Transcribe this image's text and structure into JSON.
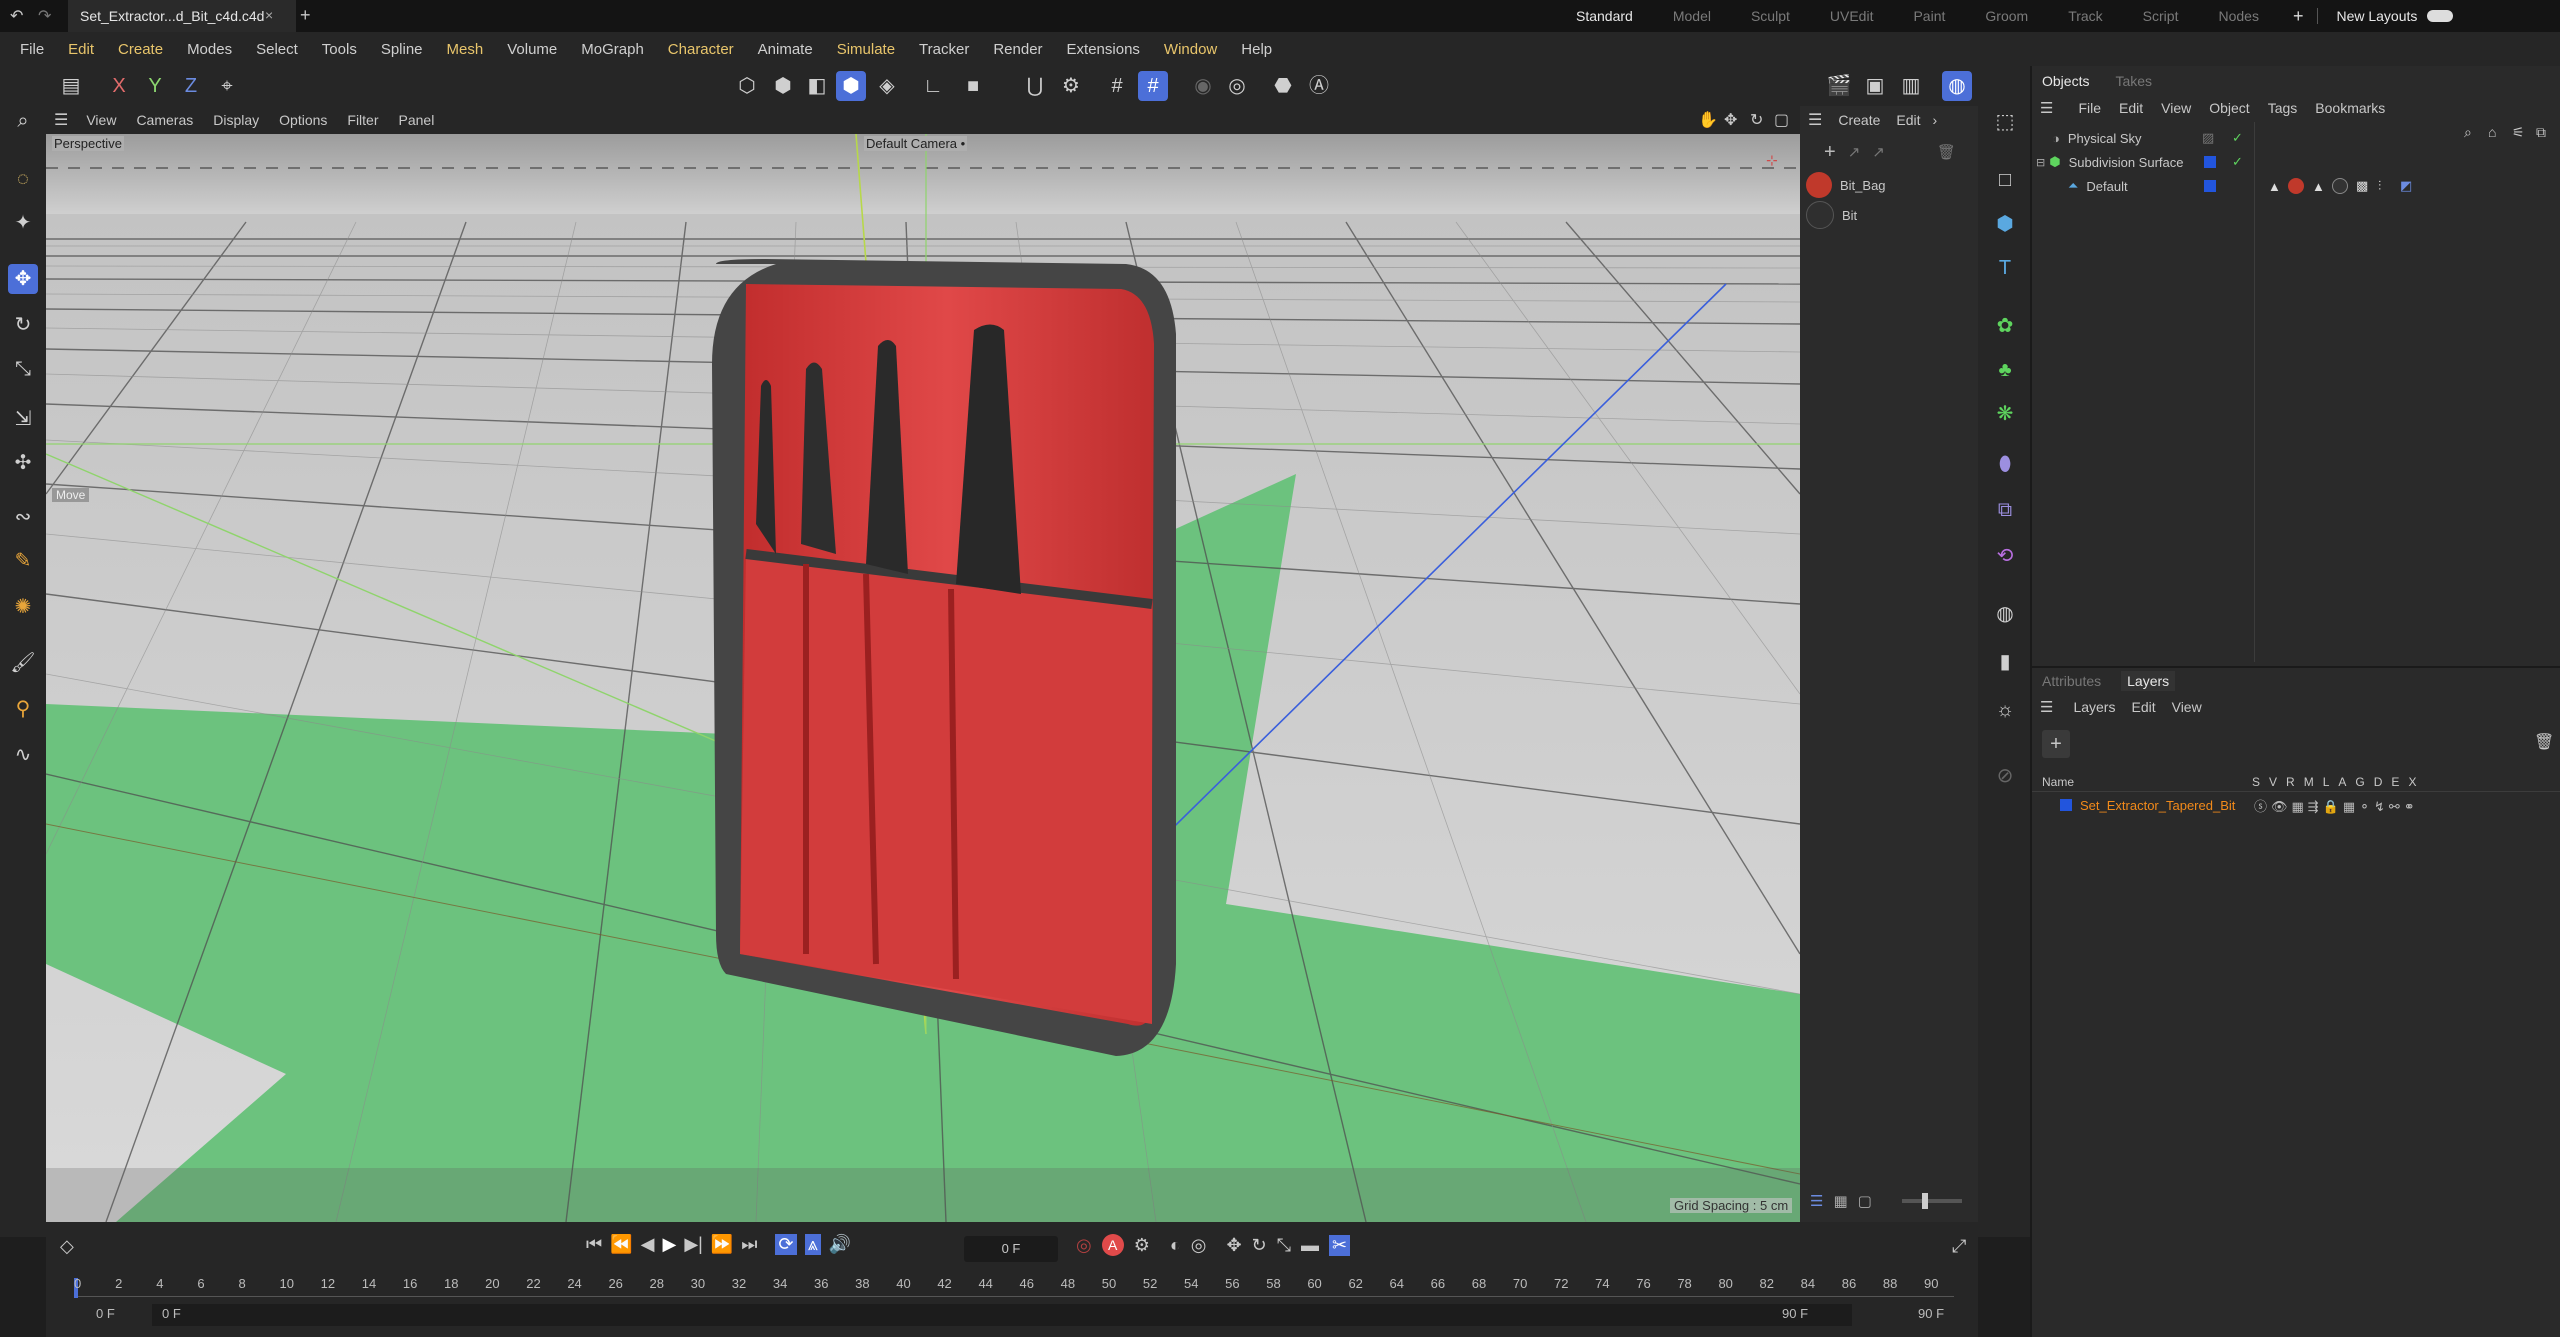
{
  "tabs": {
    "doc_tab": "Set_Extractor...d_Bit_c4d.c4d",
    "close": "×",
    "add": "+"
  },
  "layouts": {
    "items": [
      "Standard",
      "Model",
      "Sculpt",
      "UVEdit",
      "Paint",
      "Groom",
      "Track",
      "Script",
      "Nodes"
    ],
    "add": "+",
    "new_layouts": "New Layouts"
  },
  "menu": [
    "File",
    "Edit",
    "Create",
    "Modes",
    "Select",
    "Tools",
    "Spline",
    "Mesh",
    "Volume",
    "MoGraph",
    "Character",
    "Animate",
    "Simulate",
    "Tracker",
    "Render",
    "Extensions",
    "Window",
    "Help"
  ],
  "viewport": {
    "menu": [
      "View",
      "Cameras",
      "Display",
      "Options",
      "Filter",
      "Panel"
    ],
    "view_label": "Perspective",
    "camera_label": "Default Camera",
    "camera_suffix": "•",
    "hud_tool": "Move",
    "grid_spacing": "Grid Spacing : 5 cm"
  },
  "materials": {
    "menu": [
      "Create",
      "Edit"
    ],
    "items": [
      {
        "name": "Bit_Bag",
        "color": "#c0392b"
      },
      {
        "name": "Bit",
        "color": "#2f2f2f"
      }
    ]
  },
  "objects": {
    "tabs": [
      "Objects",
      "Takes"
    ],
    "menu": [
      "File",
      "Edit",
      "View",
      "Object",
      "Tags",
      "Bookmarks"
    ],
    "tree": [
      {
        "name": "Physical Sky",
        "level": 0,
        "check": "✓"
      },
      {
        "name": "Subdivision Surface",
        "level": 0,
        "check": "✓"
      },
      {
        "name": "Default",
        "level": 1,
        "check": ""
      }
    ]
  },
  "layers": {
    "tabs": [
      "Attributes",
      "Layers"
    ],
    "menu": [
      "Layers",
      "Edit",
      "View"
    ],
    "col_name": "Name",
    "flags": [
      "S",
      "V",
      "R",
      "M",
      "L",
      "A",
      "G",
      "D",
      "E",
      "X"
    ],
    "rows": [
      {
        "name": "Set_Extractor_Tapered_Bit",
        "color": "#2255dd"
      }
    ]
  },
  "timeline": {
    "current_frame": "0 F",
    "ruler": [
      "0",
      "2",
      "4",
      "6",
      "8",
      "10",
      "12",
      "14",
      "16",
      "18",
      "20",
      "22",
      "24",
      "26",
      "28",
      "30",
      "32",
      "34",
      "36",
      "38",
      "40",
      "42",
      "44",
      "46",
      "48",
      "50",
      "52",
      "54",
      "56",
      "58",
      "60",
      "62",
      "64",
      "66",
      "68",
      "70",
      "72",
      "74",
      "76",
      "78",
      "80",
      "82",
      "84",
      "86",
      "88",
      "90"
    ],
    "range_start": "0 F",
    "range_min": "0 F",
    "range_end": "90 F",
    "range_max": "90 F"
  },
  "colors": {
    "accent": "#4c6fd8",
    "active_menu": "#e8c56b",
    "green_floor": "#6cc27e",
    "bag_red": "#d43a3a",
    "layer_name": "#f28a1a"
  }
}
